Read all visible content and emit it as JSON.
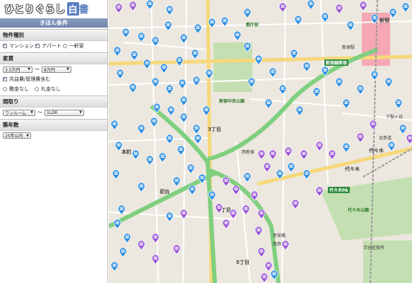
{
  "logo": {
    "main": "ひとりぐらし",
    "mark": "白",
    "tail": "書"
  },
  "panel": {
    "title": "きほん条件"
  },
  "property_type": {
    "title": "物件種別",
    "options": [
      {
        "label": "マンション",
        "checked": true
      },
      {
        "label": "アパート",
        "checked": true
      },
      {
        "label": "一軒家",
        "checked": false
      }
    ]
  },
  "rent": {
    "title": "家賃",
    "min": "3.5万円",
    "max": "8万円",
    "range_sep": "〜",
    "include_fees": "共益費/管理費含む",
    "no_deposit": "敷金なし",
    "no_key_money": "礼金なし"
  },
  "layout": {
    "title": "間取り",
    "min": "ワンルーム",
    "max": "1LDK",
    "range_sep": "〜"
  },
  "age": {
    "title": "築年数",
    "value": "25年以内"
  },
  "map": {
    "labels": {
      "shinjuku": "新宿",
      "shinjuku_station": "新宿駅",
      "minami_shinjuku": "新宿線新宿",
      "tocho": "都庁前",
      "yoyogi": "代々木",
      "hatsudai": "初台",
      "honmachi": "本町",
      "sangubashi": "参宮橋",
      "yoyogi_park": "代々木公園",
      "central_park": "新宿中央公園",
      "yoyogi_pa": "代々木PA",
      "chome3": "3丁目",
      "chome4": "4丁目",
      "chome5": "5丁目",
      "nishi_shinjuku": "西新宿",
      "nishi_station": "新宿",
      "sennagaya": "千駄ヶ谷",
      "nishisando": "西参道",
      "kitasando": "北参道",
      "shibuya_ward": "渋谷区役所"
    }
  },
  "colors": {
    "header": "#6f83ad",
    "pin_blue": "#2f8fe0",
    "pin_purple": "#9a55d6",
    "park": "#c4dfb1",
    "highway": "#7fcf7f",
    "major_road": "#f6d87a",
    "station": "#f28a9a"
  }
}
